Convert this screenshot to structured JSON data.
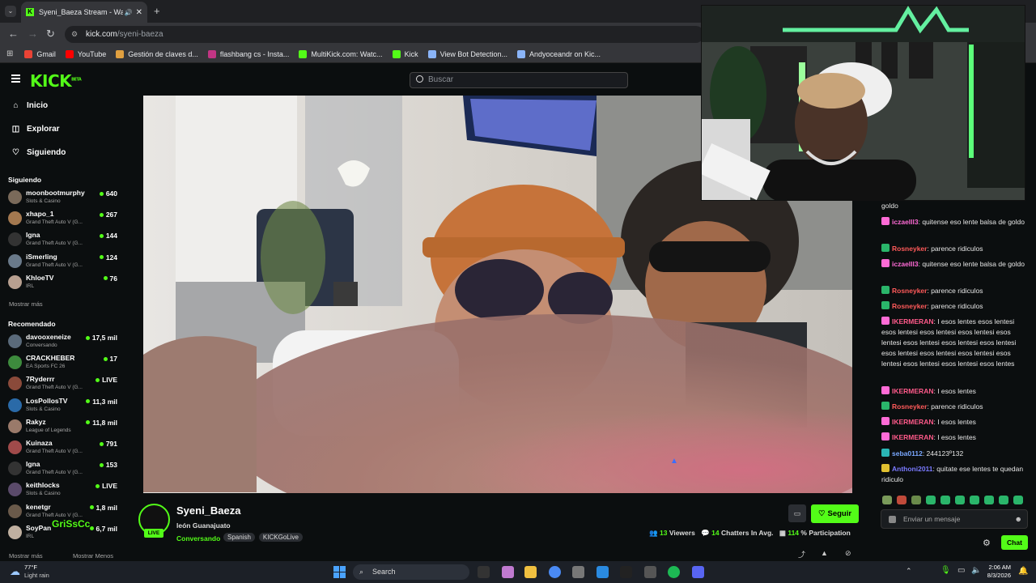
{
  "browser": {
    "tab_title": "Syeni_Baeza Stream - Watc",
    "tab_favicon": "kick-icon",
    "url_host": "kick.com",
    "url_path": "/syeni-baeza",
    "bookmarks": [
      {
        "label": "Gmail",
        "icon": "gmail-icon",
        "color": "#ea4335"
      },
      {
        "label": "YouTube",
        "icon": "youtube-icon",
        "color": "#ff0000"
      },
      {
        "label": "Gestión de claves d...",
        "icon": "key-icon",
        "color": "#e0a040"
      },
      {
        "label": "flashbang cs - Insta...",
        "icon": "instagram-icon",
        "color": "#c13584"
      },
      {
        "label": "MultiKick.com: Watc...",
        "icon": "multikick-icon",
        "color": "#53fc18"
      },
      {
        "label": "Kick",
        "icon": "kick-icon",
        "color": "#53fc18"
      },
      {
        "label": "View Bot Detection...",
        "icon": "eye-icon",
        "color": "#8ab4f8"
      },
      {
        "label": "Andyoceandr on Kic...",
        "icon": "kick-icon",
        "color": "#8ab4f8"
      }
    ]
  },
  "header": {
    "logo": "KICK",
    "logo_tag": "BETA",
    "search_placeholder": "Buscar"
  },
  "sidebar": {
    "nav": [
      {
        "label": "Inicio",
        "icon": "home-icon"
      },
      {
        "label": "Explorar",
        "icon": "compass-icon"
      },
      {
        "label": "Siguiendo",
        "icon": "heart-icon"
      }
    ],
    "following_title": "Siguiendo",
    "following": [
      {
        "name": "moonbootmurphy",
        "category": "Slots & Casino",
        "viewers": "640",
        "color": "#7a6a5a"
      },
      {
        "name": "xhapo_1",
        "category": "Grand Theft Auto V (G...",
        "viewers": "267",
        "color": "#a3784f"
      },
      {
        "name": "Igna",
        "category": "Grand Theft Auto V (G...",
        "viewers": "144",
        "color": "#333"
      },
      {
        "name": "iSmerling",
        "category": "Grand Theft Auto V (G...",
        "viewers": "124",
        "color": "#6a7a8a"
      },
      {
        "name": "KhloeTV",
        "category": "IRL",
        "viewers": "76",
        "color": "#b8a090"
      }
    ],
    "following_more": "Mostrar más",
    "recommended_title": "Recomendado",
    "recommended": [
      {
        "name": "davooxeneize",
        "category": "Conversando",
        "viewers": "17,5 mil",
        "color": "#5a6a7a"
      },
      {
        "name": "CRACKHEBER",
        "category": "EA Sports FC 26",
        "viewers": "17",
        "color": "#3d8b3d"
      },
      {
        "name": "7Ryderrr",
        "category": "Grand Theft Auto V (G...",
        "viewers": "LIVE",
        "color": "#8a4a3a"
      },
      {
        "name": "LosPollosTV",
        "category": "Slots & Casino",
        "viewers": "11,3 mil",
        "color": "#2a6aa8"
      },
      {
        "name": "Rakyz",
        "category": "League of Legends",
        "viewers": "11,8 mil",
        "color": "#9a7a6a"
      },
      {
        "name": "Kuinaza",
        "category": "Grand Theft Auto V (G...",
        "viewers": "791",
        "color": "#a04a4a"
      },
      {
        "name": "Igna",
        "category": "Grand Theft Auto V (G...",
        "viewers": "153",
        "color": "#333"
      },
      {
        "name": "keithlocks",
        "category": "Slots & Casino",
        "viewers": "LIVE",
        "color": "#5a4a6a"
      },
      {
        "name": "kenetgr",
        "category": "Grand Theft Auto V (G...",
        "viewers": "1,8 mil",
        "color": "#6a5a4a"
      },
      {
        "name": "SoyPan",
        "category": "IRL",
        "viewers": "6,7 mil",
        "color": "#c0b0a0"
      }
    ],
    "recommended_more": "Mostrar más",
    "recommended_less": "Mostrar Menos",
    "overlay_name": "GriSsCc"
  },
  "stream": {
    "channel": "Syeni_Baeza",
    "title": "león Guanajuato",
    "live_badge": "LIVE",
    "category": "Conversando",
    "tags": [
      "Spanish",
      "KICKGoLive"
    ],
    "follow_label": "Seguir",
    "viewers_count": "13",
    "viewers_label": "Viewers",
    "chatters_count": "14",
    "chatters_label": "Chatters In Avg.",
    "participation_value": "114",
    "participation_label": "% Participation"
  },
  "chat": {
    "messages": [
      {
        "user": "",
        "text": "goldo",
        "color": "#ff6bd6",
        "badge": "#ff6bd6"
      },
      {
        "user": "iczaelll3",
        "text": ": quitense eso lente balsa de goldo",
        "color": "#ff6bd6",
        "badge": "#ff6bd6"
      },
      {
        "user": "Rosneyker",
        "text": ": parence ridiculos",
        "color": "#ff5a5a",
        "badge": "#2ab56a"
      },
      {
        "user": "iczaelll3",
        "text": ": quitense eso lente balsa de goldo",
        "color": "#ff6bd6",
        "badge": "#ff6bd6"
      },
      {
        "user": "Rosneyker",
        "text": ": parence ridiculos",
        "color": "#ff5a5a",
        "badge": "#2ab56a"
      },
      {
        "user": "Rosneyker",
        "text": ": parence ridiculos",
        "color": "#ff5a5a",
        "badge": "#2ab56a"
      },
      {
        "user": "IKERMERAN",
        "text": ": I esos lentes esos lentesi esos lentesi esos lentesi esos lentesi esos lentesi esos lentesi esos lentesi esos lentesi esos lentesi esos lentesi esos lentesi esos lentesi esos lentesi esos lentesi esos lentes",
        "color": "#ff5a8a",
        "badge": "#ff6bd6"
      },
      {
        "user": "IKERMERAN",
        "text": ": I esos lentes",
        "color": "#ff5a8a",
        "badge": "#ff6bd6"
      },
      {
        "user": "Rosneyker",
        "text": ": parence ridiculos",
        "color": "#ff5a5a",
        "badge": "#2ab56a"
      },
      {
        "user": "IKERMERAN",
        "text": ": I esos lentes",
        "color": "#ff5a8a",
        "badge": "#ff6bd6"
      },
      {
        "user": "IKERMERAN",
        "text": ": I esos lentes",
        "color": "#ff5a8a",
        "badge": "#ff6bd6"
      },
      {
        "user": "seba0112",
        "text": ": 244123º132",
        "color": "#7aa8ff",
        "badge": "#2ab5b5"
      },
      {
        "user": "Anthoni2011",
        "text": ": quitate ese lentes te quedan ridiculo",
        "color": "#7a7aff",
        "badge": "#e0c030"
      }
    ],
    "input_placeholder": "Enviar un mensaje",
    "chat_button": "Chat"
  },
  "taskbar": {
    "weather_temp": "77°F",
    "weather_desc": "Light rain",
    "search_label": "Search",
    "time": "2:06 AM",
    "date": "8/3/2026"
  }
}
